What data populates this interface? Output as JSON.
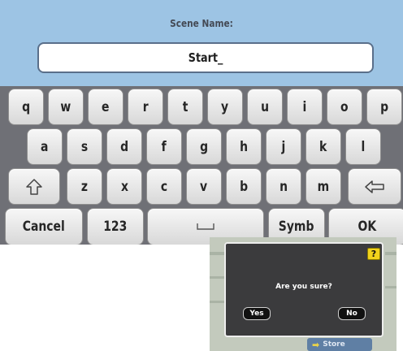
{
  "keyboard": {
    "title": "Scene Name:",
    "field_value": "Start_",
    "row1": [
      "q",
      "w",
      "e",
      "r",
      "t",
      "y",
      "u",
      "i",
      "o",
      "p"
    ],
    "row2": [
      "a",
      "s",
      "d",
      "f",
      "g",
      "h",
      "j",
      "k",
      "l"
    ],
    "row3": [
      "z",
      "x",
      "c",
      "v",
      "b",
      "n",
      "m"
    ],
    "shift_icon": "shift-arrow-icon",
    "backspace_icon": "backspace-arrow-icon",
    "space_icon": "space-bar-icon",
    "cancel_label": "Cancel",
    "numbers_label": "123",
    "symbols_label": "Symb",
    "ok_label": "OK",
    "header_color": "#9dc4e4",
    "key_color": "#e8e8e8"
  },
  "dialog": {
    "help_label": "?",
    "message": "Are you sure?",
    "yes_label": "Yes",
    "no_label": "No",
    "background_button_label": "Store",
    "help_color": "#f1d31c"
  }
}
